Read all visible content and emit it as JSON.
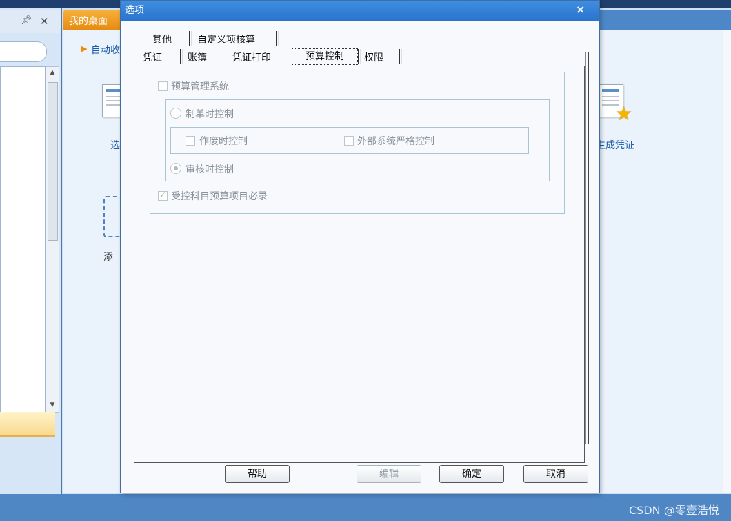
{
  "background": {
    "desktop_tab": "我的桌面",
    "auto_collect": "自动收",
    "option_label": "选",
    "add_label": "添",
    "generate_voucher": "生成凭证",
    "watermark": "CSDN @零壹浩悦",
    "icons": {
      "pin": "pin-icon",
      "close": "close-icon"
    }
  },
  "dialog": {
    "title": "选项",
    "close_glyph": "×",
    "tabs_row1": [
      "其他",
      "自定义项核算"
    ],
    "tabs_row2": [
      "凭证",
      "账簿",
      "凭证打印",
      "预算控制",
      "权限"
    ],
    "active_tab": "预算控制",
    "budget": {
      "budget_system": {
        "label": "预算管理系统",
        "checked": false
      },
      "make_control": {
        "label": "制单时控制",
        "selected": false
      },
      "void_control": {
        "label": "作废时控制",
        "checked": false
      },
      "external_control": {
        "label": "外部系统严格控制",
        "checked": false
      },
      "audit_control": {
        "label": "审核时控制",
        "selected": true
      },
      "required": {
        "label": "受控科目预算项目必录",
        "checked": true
      }
    },
    "buttons": {
      "help": "帮助",
      "edit": "编辑",
      "ok": "确定",
      "cancel": "取消"
    }
  },
  "colors": {
    "titlebar": "#2a73cc",
    "accent_tab": "#e68a10",
    "status_bar": "#4f86c4"
  }
}
